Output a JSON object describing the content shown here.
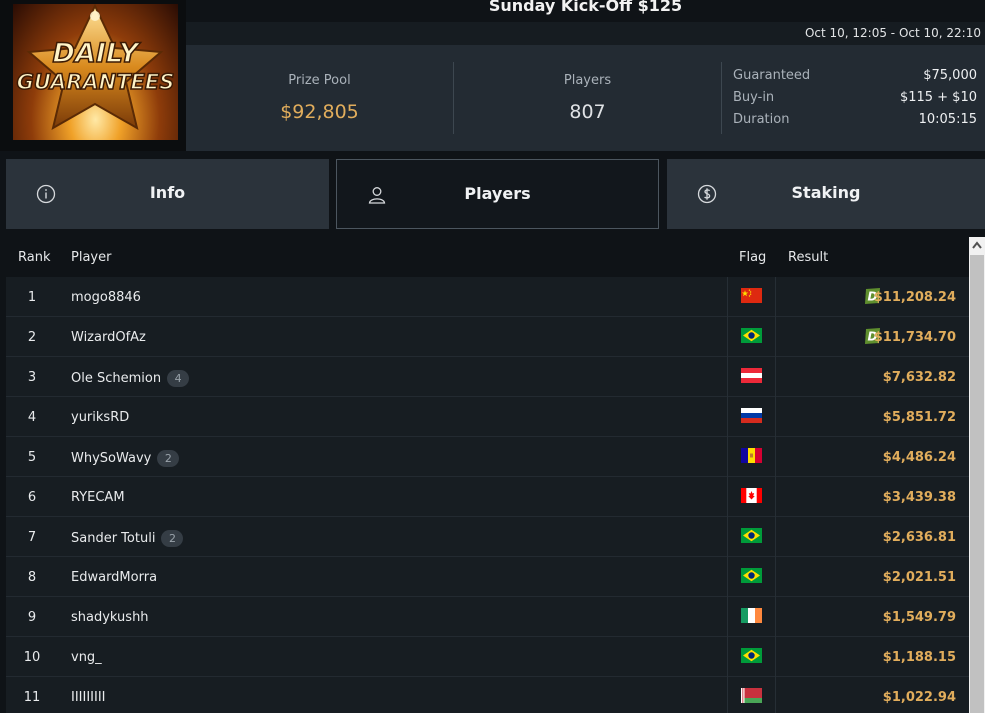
{
  "header": {
    "title": "Sunday Kick-Off $125",
    "dates": "Oct 10, 12:05 - Oct 10, 22:10",
    "logo_line1": "DAILY",
    "logo_line2": "GUARANTEES",
    "prize_pool_label": "Prize Pool",
    "prize_pool_value": "$92,805",
    "players_label": "Players",
    "players_value": "807",
    "meta": [
      {
        "key": "Guaranteed",
        "value": "$75,000"
      },
      {
        "key": "Buy-in",
        "value": "$115 + $10"
      },
      {
        "key": "Duration",
        "value": "10:05:15"
      }
    ]
  },
  "tabs": [
    {
      "label": "Info",
      "icon": "info-icon"
    },
    {
      "label": "Players",
      "icon": "user-icon"
    },
    {
      "label": "Staking",
      "icon": "dollar-circle-icon"
    }
  ],
  "active_tab": "Players",
  "table": {
    "columns": {
      "rank": "Rank",
      "player": "Player",
      "flag": "Flag",
      "result": "Result"
    },
    "rows": [
      {
        "rank": "1",
        "player": "mogo8846",
        "badge": "",
        "flag": "china",
        "result": "$11,208.24",
        "d_badge": true
      },
      {
        "rank": "2",
        "player": "WizardOfAz",
        "badge": "",
        "flag": "brazil",
        "result": "$11,734.70",
        "d_badge": true
      },
      {
        "rank": "3",
        "player": "Ole Schemion",
        "badge": "4",
        "flag": "austria",
        "result": "$7,632.82",
        "d_badge": false
      },
      {
        "rank": "4",
        "player": "yuriksRD",
        "badge": "",
        "flag": "russia",
        "result": "$5,851.72",
        "d_badge": false
      },
      {
        "rank": "5",
        "player": "WhySoWavy",
        "badge": "2",
        "flag": "andorra",
        "result": "$4,486.24",
        "d_badge": false
      },
      {
        "rank": "6",
        "player": "RYECAM",
        "badge": "",
        "flag": "canada",
        "result": "$3,439.38",
        "d_badge": false
      },
      {
        "rank": "7",
        "player": "Sander Totuli",
        "badge": "2",
        "flag": "brazil",
        "result": "$2,636.81",
        "d_badge": false
      },
      {
        "rank": "8",
        "player": "EdwardMorra",
        "badge": "",
        "flag": "brazil",
        "result": "$2,021.51",
        "d_badge": false
      },
      {
        "rank": "9",
        "player": "shadykushh",
        "badge": "",
        "flag": "ireland",
        "result": "$1,549.79",
        "d_badge": false
      },
      {
        "rank": "10",
        "player": "vng_",
        "badge": "",
        "flag": "brazil",
        "result": "$1,188.15",
        "d_badge": false
      },
      {
        "rank": "11",
        "player": "IIIIIIIII",
        "badge": "",
        "flag": "belarus",
        "result": "$1,022.94",
        "d_badge": false
      }
    ]
  },
  "colors": {
    "accent_gold": "#e1ad5c",
    "d_badge_green": "#5f8f2e",
    "background": "#171d22"
  }
}
